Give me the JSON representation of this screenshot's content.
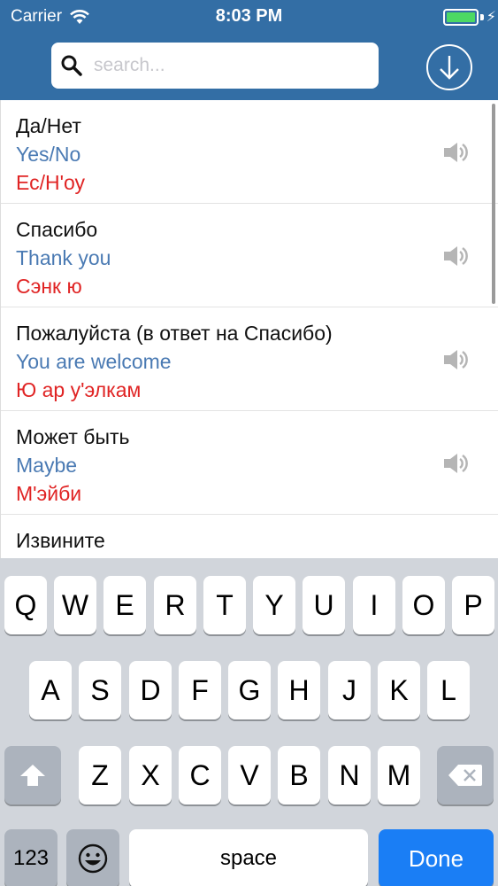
{
  "status": {
    "carrier": "Carrier",
    "time": "8:03 PM",
    "battery_color": "#4cd964"
  },
  "search": {
    "placeholder": "search..."
  },
  "nav": {
    "download_icon": "download-circle-icon"
  },
  "list": [
    {
      "ru": "Да/Нет",
      "en": "Yes/No",
      "tr": "Ес/Н'оу"
    },
    {
      "ru": "Спасибо",
      "en": "Thank you",
      "tr": "Сэнк ю"
    },
    {
      "ru": "Пожалуйста (в ответ на Спасибо)",
      "en": "You are welcome",
      "tr": "Ю ар у'элкам"
    },
    {
      "ru": "Может быть",
      "en": "Maybe",
      "tr": "М'эйби"
    },
    {
      "ru": "Извините",
      "en": "",
      "tr": ""
    }
  ],
  "keyboard": {
    "row1": [
      "Q",
      "W",
      "E",
      "R",
      "T",
      "Y",
      "U",
      "I",
      "O",
      "P"
    ],
    "row2": [
      "A",
      "S",
      "D",
      "F",
      "G",
      "H",
      "J",
      "K",
      "L"
    ],
    "row3": [
      "Z",
      "X",
      "C",
      "V",
      "B",
      "N",
      "M"
    ],
    "numbers": "123",
    "space": "space",
    "done": "Done"
  },
  "colors": {
    "header": "#336ea5",
    "english": "#4a7ab3",
    "transcription": "#e02424",
    "done": "#1a7ef5"
  }
}
